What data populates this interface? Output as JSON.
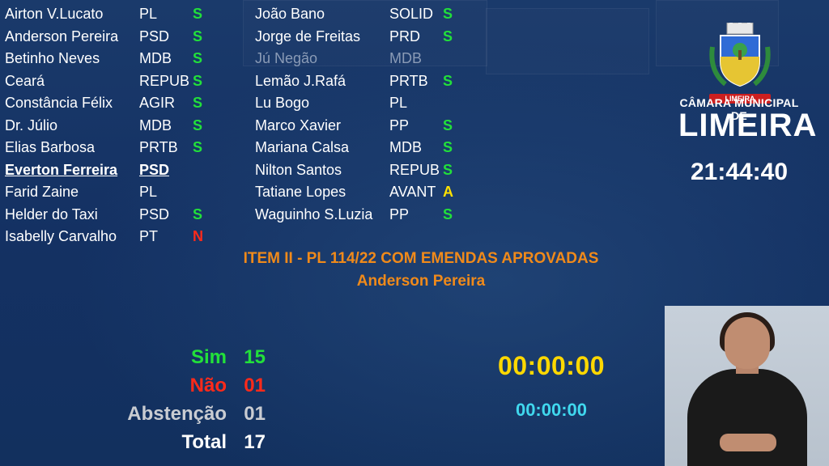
{
  "councilors_col1": [
    {
      "name": "Airton V.Lucato",
      "party": "PL",
      "vote": "S"
    },
    {
      "name": "Anderson Pereira",
      "party": "PSD",
      "vote": "S"
    },
    {
      "name": "Betinho Neves",
      "party": "MDB",
      "vote": "S"
    },
    {
      "name": "Ceará",
      "party": "REPUB",
      "vote": "S"
    },
    {
      "name": "Constância Félix",
      "party": "AGIR",
      "vote": "S"
    },
    {
      "name": "Dr. Júlio",
      "party": "MDB",
      "vote": "S"
    },
    {
      "name": "Elias Barbosa",
      "party": "PRTB",
      "vote": "S"
    },
    {
      "name": "Everton Ferreira",
      "party": "PSD",
      "vote": ""
    },
    {
      "name": "Farid Zaine",
      "party": "PL",
      "vote": ""
    },
    {
      "name": "Helder do Taxi",
      "party": "PSD",
      "vote": "S"
    },
    {
      "name": "Isabelly Carvalho",
      "party": "PT",
      "vote": "N"
    }
  ],
  "councilors_col2": [
    {
      "name": "João Bano",
      "party": "SOLID",
      "vote": "S"
    },
    {
      "name": "Jorge de Freitas",
      "party": "PRD",
      "vote": "S"
    },
    {
      "name": "Jú Negão",
      "party": "MDB",
      "vote": ""
    },
    {
      "name": "Lemão J.Rafá",
      "party": "PRTB",
      "vote": "S"
    },
    {
      "name": "Lu Bogo",
      "party": "PL",
      "vote": ""
    },
    {
      "name": "Marco Xavier",
      "party": "PP",
      "vote": "S"
    },
    {
      "name": "Mariana Calsa",
      "party": "MDB",
      "vote": "S"
    },
    {
      "name": "Nilton Santos",
      "party": "REPUB",
      "vote": "S"
    },
    {
      "name": "Tatiane Lopes",
      "party": "AVANT",
      "vote": "A"
    },
    {
      "name": "Waguinho S.Luzia",
      "party": "PP",
      "vote": "S"
    }
  ],
  "item": {
    "title": "ITEM II - PL 114/22 COM EMENDAS APROVADAS",
    "author": "Anderson Pereira"
  },
  "tally": {
    "sim_label": "Sim",
    "sim_value": "15",
    "nao_label": "Não",
    "nao_value": "01",
    "abstencao_label": "Abstenção",
    "abstencao_value": "01",
    "total_label": "Total",
    "total_value": "17"
  },
  "timers": {
    "main": "00:00:00",
    "secondary": "00:00:00"
  },
  "header": {
    "camara": "CÂMARA MUNICIPAL DE",
    "city": "LIMEIRA",
    "clock": "21:44:40",
    "crest_text": "LIMEIRA"
  },
  "colors": {
    "vote_yes": "#22e03a",
    "vote_no": "#ff2a1a",
    "vote_abstain": "#ffe100",
    "item_text": "#f08a1a",
    "timer_main": "#ffd800",
    "timer_secondary": "#40d8ee",
    "background": "#163562"
  }
}
